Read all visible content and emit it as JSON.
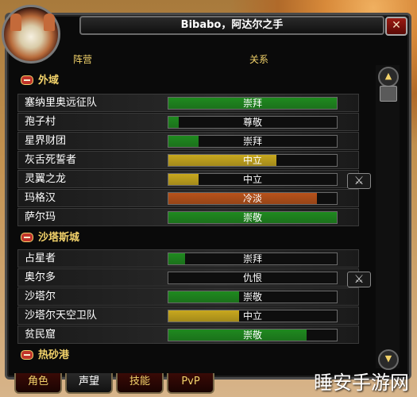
{
  "window": {
    "title": "Bibabo，阿达尔之手",
    "close_label": "✕"
  },
  "columns": {
    "faction": "阵营",
    "relation": "关系"
  },
  "colors": {
    "green": "#1f8a1f",
    "yellow": "#c8a81e",
    "orange": "#b8521a",
    "frame": "#0a0a0a",
    "gold_text": "#f2d26a"
  },
  "groups": [
    {
      "name": "外域",
      "collapse_icon": "minus-icon"
    },
    {
      "name": "沙塔斯城",
      "collapse_icon": "minus-icon"
    },
    {
      "name": "热砂港",
      "collapse_icon": "minus-icon"
    }
  ],
  "factions": [
    {
      "name": "塞纳里奥远征队",
      "standing": "崇拜",
      "progress": 1.0,
      "color": "#1f8a1f",
      "at_war_toggle": false
    },
    {
      "name": "孢子村",
      "standing": "尊敬",
      "progress": 0.06,
      "color": "#1f8a1f",
      "at_war_toggle": false
    },
    {
      "name": "星界财团",
      "standing": "崇拜",
      "progress": 0.18,
      "color": "#1f8a1f",
      "at_war_toggle": false
    },
    {
      "name": "灰舌死誓者",
      "standing": "中立",
      "progress": 0.64,
      "color": "#c8a81e",
      "at_war_toggle": false
    },
    {
      "name": "灵翼之龙",
      "standing": "中立",
      "progress": 0.18,
      "color": "#c8a81e",
      "at_war_toggle": true
    },
    {
      "name": "玛格汉",
      "standing": "冷淡",
      "progress": 0.88,
      "color": "#b8521a",
      "at_war_toggle": false
    },
    {
      "name": "萨尔玛",
      "standing": "崇敬",
      "progress": 1.0,
      "color": "#1f8a1f",
      "at_war_toggle": false
    },
    {
      "name": "占星者",
      "standing": "崇拜",
      "progress": 0.1,
      "color": "#1f8a1f",
      "at_war_toggle": false
    },
    {
      "name": "奥尔多",
      "standing": "仇恨",
      "progress": 0.0,
      "color": "#b8521a",
      "at_war_toggle": true
    },
    {
      "name": "沙塔尔",
      "standing": "崇敬",
      "progress": 0.42,
      "color": "#1f8a1f",
      "at_war_toggle": false
    },
    {
      "name": "沙塔尔天空卫队",
      "standing": "中立",
      "progress": 0.42,
      "color": "#c8a81e",
      "at_war_toggle": false
    },
    {
      "name": "贫民窟",
      "standing": "崇敬",
      "progress": 0.82,
      "color": "#1f8a1f",
      "at_war_toggle": false
    }
  ],
  "tabs": [
    {
      "label": "角色",
      "active": false
    },
    {
      "label": "声望",
      "active": true
    },
    {
      "label": "技能",
      "active": false
    },
    {
      "label": "PvP",
      "active": false
    }
  ],
  "watermark": "睡安手游网"
}
